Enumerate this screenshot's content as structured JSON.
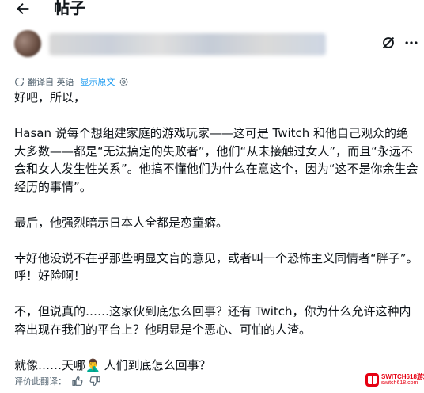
{
  "header": {
    "title": "帖子"
  },
  "translation": {
    "label": "翻译自 英语",
    "show_original": "显示原文"
  },
  "post": {
    "paragraphs": [
      "好吧，所以，",
      "",
      "Hasan 说每个想组建家庭的游戏玩家——这可是 Twitch 和他自己观众的绝大多数——都是“无法搞定的失败者”，他们“从未接触过女人”，而且“永远不会和女人发生性关系”。他搞不懂他们为什么在意这个，因为“这不是你余生会经历的事情”。",
      "",
      "最后，他强烈暗示日本人全都是恋童癖。",
      "",
      "幸好他没说不在乎那些明显文盲的意见，或者叫一个恐怖主义同情者“胖子”。呼！好险啊！",
      "",
      "不，但说真的……这家伙到底怎么回事？还有 Twitch，你为什么允许这种内容出现在我们的平台上？他明显是个恶心、可怕的人渣。",
      "",
      "就像……天哪🤦‍♂️ 人们到底怎么回事？"
    ]
  },
  "rating": {
    "label": "评价此翻译："
  },
  "watermark": {
    "line1": "SWITCH618游戏",
    "line2": "switch618.com"
  },
  "icons": {
    "back": "arrow-left-icon",
    "grok": "grok-icon",
    "more": "more-horizontal-icon",
    "translate": "translate-icon",
    "settings": "gear-icon",
    "thumb_up": "thumbs-up-icon",
    "thumb_down": "thumbs-down-icon"
  },
  "colors": {
    "link": "#1d9bf0",
    "muted": "#536471",
    "text": "#0f1419",
    "watermark": "#e60012"
  }
}
